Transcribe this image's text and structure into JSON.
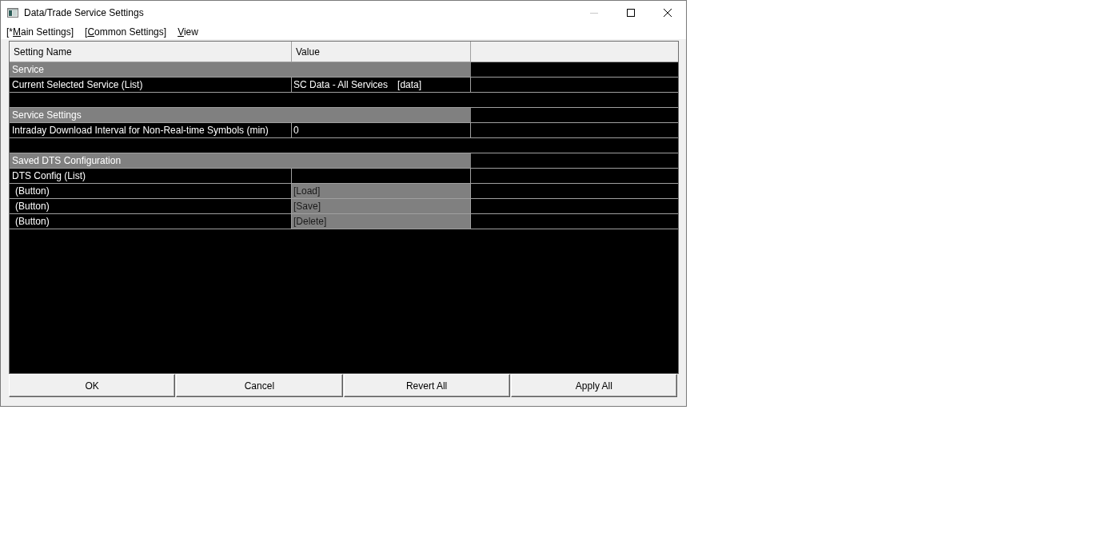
{
  "window": {
    "title": "Data/Trade Service Settings",
    "controls": [
      {
        "kind": "minimize",
        "disabled": true
      },
      {
        "kind": "maximize",
        "disabled": false
      },
      {
        "kind": "close",
        "disabled": false
      }
    ]
  },
  "menu": [
    {
      "before": "[*",
      "access_key": "M",
      "after": "ain Settings]"
    },
    {
      "before": "[",
      "access_key": "C",
      "after": "ommon Settings]"
    },
    {
      "access_key": "V",
      "after": "iew"
    }
  ],
  "table": {
    "columns": [
      "Setting Name",
      "Value"
    ],
    "rows": [
      {
        "kind": "section",
        "label": "Service"
      },
      {
        "kind": "setting",
        "name": "Current Selected Service (List)",
        "value": "SC Data - All Services",
        "tag": "[data]"
      },
      {
        "kind": "blank"
      },
      {
        "kind": "section",
        "label": "Service Settings"
      },
      {
        "kind": "setting",
        "name": "Intraday Download Interval for Non-Real-time Symbols (min)",
        "value": "0"
      },
      {
        "kind": "blank"
      },
      {
        "kind": "section",
        "label": "Saved DTS Configuration"
      },
      {
        "kind": "setting",
        "name": "DTS Config (List)"
      },
      {
        "kind": "button",
        "name": "(Button)",
        "value": "[Load]"
      },
      {
        "kind": "button",
        "name": "(Button)",
        "value": "[Save]"
      },
      {
        "kind": "button",
        "name": "(Button)",
        "value": "[Delete]"
      }
    ]
  },
  "buttons": [
    "OK",
    "Cancel",
    "Revert All",
    "Apply All"
  ]
}
